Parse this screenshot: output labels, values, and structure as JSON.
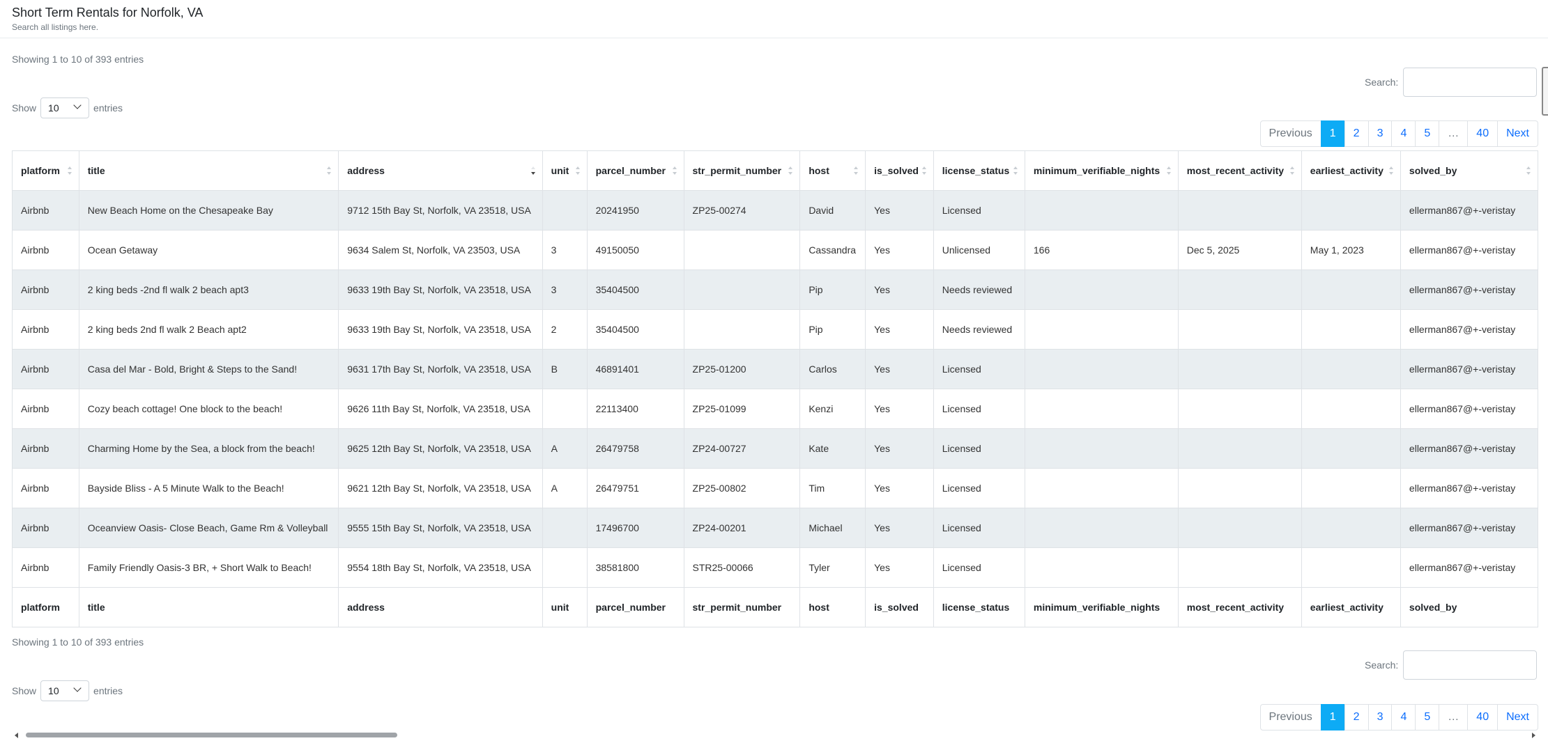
{
  "header": {
    "title": "Short Term Rentals for Norfolk, VA",
    "subtitle": "Search all listings here."
  },
  "top": {
    "info": "Showing 1 to 10 of 393 entries",
    "search_label": "Search:",
    "search_value": "",
    "length_show": "Show",
    "length_value": "10",
    "length_entries": "entries"
  },
  "bottom": {
    "info": "Showing 1 to 10 of 393 entries",
    "search_label": "Search:",
    "search_value": "",
    "length_show": "Show",
    "length_value": "10",
    "length_entries": "entries"
  },
  "pagination": {
    "previous": "Previous",
    "pages": [
      "1",
      "2",
      "3",
      "4",
      "5"
    ],
    "ellipsis": "…",
    "last": "40",
    "next": "Next",
    "active": "1"
  },
  "table": {
    "columns": [
      "platform",
      "title",
      "address",
      "unit",
      "parcel_number",
      "str_permit_number",
      "host",
      "is_solved",
      "license_status",
      "minimum_verifiable_nights",
      "most_recent_activity",
      "earliest_activity",
      "solved_by"
    ],
    "sorted_column": "address",
    "sort_direction": "descending",
    "rows": [
      [
        "Airbnb",
        "New Beach Home on the Chesapeake Bay",
        "9712 15th Bay St, Norfolk, VA 23518, USA",
        "",
        "20241950",
        "ZP25-00274",
        "David",
        "Yes",
        "Licensed",
        "",
        "",
        "",
        "ellerman867@+-veristay"
      ],
      [
        "Airbnb",
        "Ocean Getaway",
        "9634 Salem St, Norfolk, VA 23503, USA",
        "3",
        "49150050",
        "",
        "Cassandra",
        "Yes",
        "Unlicensed",
        "166",
        "Dec 5, 2025",
        "May 1, 2023",
        "ellerman867@+-veristay"
      ],
      [
        "Airbnb",
        "2 king beds -2nd fl walk 2 beach apt3",
        "9633 19th Bay St, Norfolk, VA 23518, USA",
        "3",
        "35404500",
        "",
        "Pip",
        "Yes",
        "Needs reviewed",
        "",
        "",
        "",
        "ellerman867@+-veristay"
      ],
      [
        "Airbnb",
        "2 king beds 2nd fl walk 2 Beach apt2",
        "9633 19th Bay St, Norfolk, VA 23518, USA",
        "2",
        "35404500",
        "",
        "Pip",
        "Yes",
        "Needs reviewed",
        "",
        "",
        "",
        "ellerman867@+-veristay"
      ],
      [
        "Airbnb",
        "Casa del Mar - Bold, Bright & Steps to the Sand!",
        "9631 17th Bay St, Norfolk, VA 23518, USA",
        "B",
        "46891401",
        "ZP25-01200",
        "Carlos",
        "Yes",
        "Licensed",
        "",
        "",
        "",
        "ellerman867@+-veristay"
      ],
      [
        "Airbnb",
        "Cozy beach cottage! One block to the beach!",
        "9626 11th Bay St, Norfolk, VA 23518, USA",
        "",
        "22113400",
        "ZP25-01099",
        "Kenzi",
        "Yes",
        "Licensed",
        "",
        "",
        "",
        "ellerman867@+-veristay"
      ],
      [
        "Airbnb",
        "Charming Home by the Sea, a block from the beach!",
        "9625 12th Bay St, Norfolk, VA 23518, USA",
        "A",
        "26479758",
        "ZP24-00727",
        "Kate",
        "Yes",
        "Licensed",
        "",
        "",
        "",
        "ellerman867@+-veristay"
      ],
      [
        "Airbnb",
        "Bayside Bliss - A 5 Minute Walk to the Beach!",
        "9621 12th Bay St, Norfolk, VA 23518, USA",
        "A",
        "26479751",
        "ZP25-00802",
        "Tim",
        "Yes",
        "Licensed",
        "",
        "",
        "",
        "ellerman867@+-veristay"
      ],
      [
        "Airbnb",
        "Oceanview Oasis- Close Beach, Game Rm & Volleyball",
        "9555 15th Bay St, Norfolk, VA 23518, USA",
        "",
        "17496700",
        "ZP24-00201",
        "Michael",
        "Yes",
        "Licensed",
        "",
        "",
        "",
        "ellerman867@+-veristay"
      ],
      [
        "Airbnb",
        "Family Friendly Oasis-3 BR, + Short Walk to Beach!",
        "9554 18th Bay St, Norfolk, VA 23518, USA",
        "",
        "38581800",
        "STR25-00066",
        "Tyler",
        "Yes",
        "Licensed",
        "",
        "",
        "",
        "ellerman867@+-veristay"
      ]
    ]
  }
}
